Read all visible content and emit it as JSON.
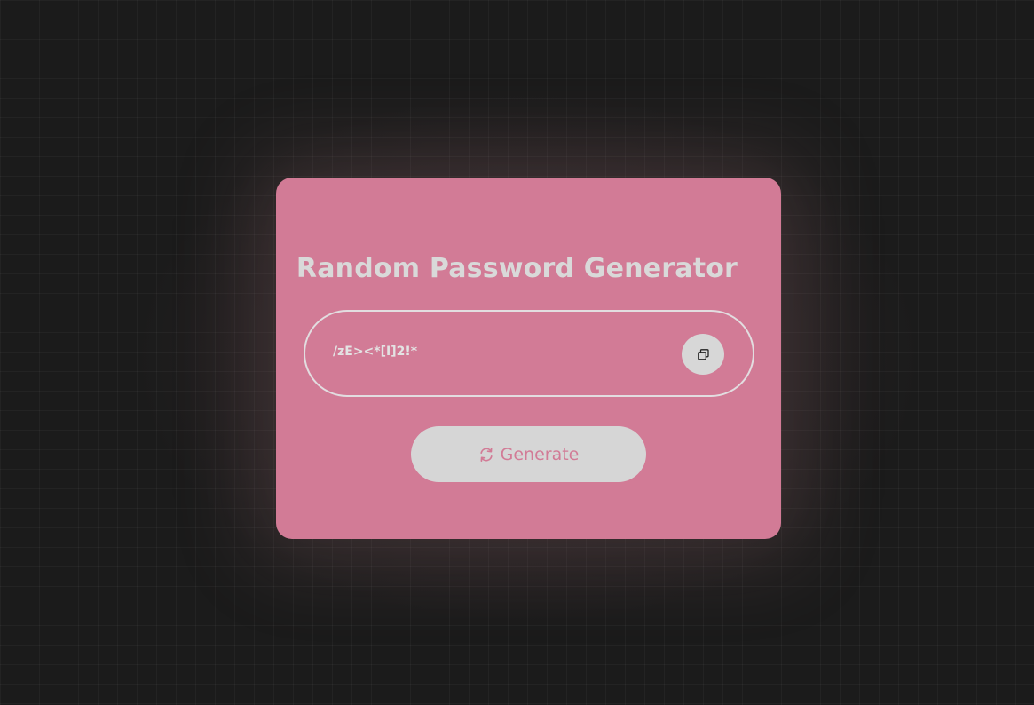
{
  "app": {
    "title": "Random Password Generator"
  },
  "password_field": {
    "value": "/zE><*[I]2!*"
  },
  "copy_button": {
    "icon": "copy-icon"
  },
  "generate_button": {
    "label": "Generate",
    "icon": "refresh-icon"
  },
  "colors": {
    "background": "#1b1b1b",
    "card": "#d27b96",
    "text_light": "#d9d9d9",
    "button": "#d6d6d6"
  }
}
